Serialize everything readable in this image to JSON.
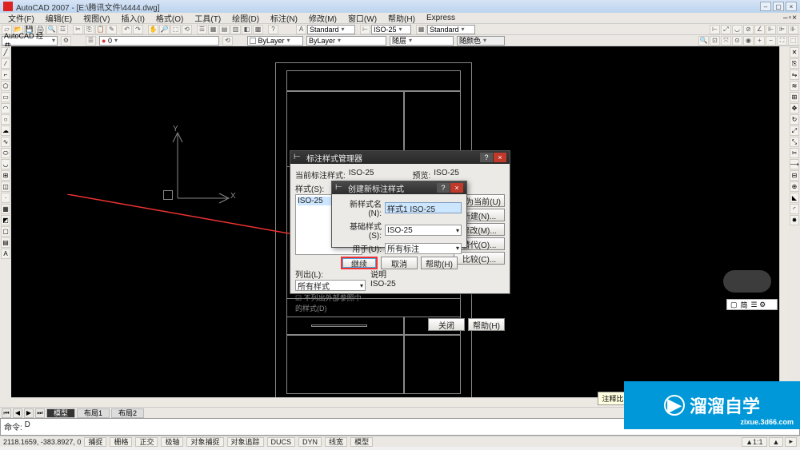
{
  "app": {
    "title": "AutoCAD 2007 - [E:\\腾讯文件\\4444.dwg]"
  },
  "menu": [
    "文件(F)",
    "编辑(E)",
    "视图(V)",
    "插入(I)",
    "格式(O)",
    "工具(T)",
    "绘图(D)",
    "标注(N)",
    "修改(M)",
    "窗口(W)",
    "帮助(H)",
    "Express"
  ],
  "toolbar2": {
    "style": "Standard",
    "dim": "ISO-25",
    "dim2": "Standard"
  },
  "layers": {
    "ws": "AutoCAD 经典",
    "layer": "0",
    "ltype": "ByLayer",
    "lweight": "ByLayer",
    "color": "随层",
    "color2": "随颜色"
  },
  "ucs": {
    "x": "X",
    "y": "Y"
  },
  "model_tabs": [
    "模型",
    "布局1",
    "布局2"
  ],
  "cmd": {
    "prompt": "命令:",
    "value": "D"
  },
  "status": {
    "coords": "2118.1659, -383.8927, 0",
    "buttons": [
      "捕捉",
      "栅格",
      "正交",
      "极轴",
      "对象捕捉",
      "对象追踪",
      "DUCS",
      "DYN",
      "线宽",
      "模型"
    ],
    "tooltip": "注释比例: 通过此按钮可更改可注释对象的注释 方法»"
  },
  "nav_panel": "简",
  "dlg_main": {
    "title": "标注样式管理器",
    "help_icon": "?",
    "close_icon": "×",
    "lbl_current": "当前标注样式:",
    "current": "ISO-25",
    "lbl_styles": "样式(S):",
    "list_item": "ISO-25",
    "lbl_preview": "预览:",
    "preview_of": "ISO-25",
    "lbl_listby": "列出(L):",
    "listby": "所有样式",
    "chk_xref": "不列出外部参照中的样式(D)",
    "lbl_desc": "说明",
    "desc": "ISO-25",
    "buttons": {
      "setcur": "置为当前(U)",
      "new": "新建(N)...",
      "modify": "修改(M)...",
      "override": "替代(O)...",
      "compare": "比较(C)..."
    },
    "close": "关闭",
    "help": "帮助(H)"
  },
  "dlg_new": {
    "title": "创建新标注样式",
    "lbl_name": "新样式名(N):",
    "name_val": "样式1 ISO-25",
    "lbl_base": "基础样式(S):",
    "base_val": "ISO-25",
    "lbl_usefor": "用于(U):",
    "usefor_val": "所有标注",
    "btn_continue": "继续",
    "btn_cancel": "取消",
    "btn_help": "帮助(H)"
  },
  "watermark": {
    "main1": "溜溜自学",
    "sub": "zixue.3d66.com"
  }
}
